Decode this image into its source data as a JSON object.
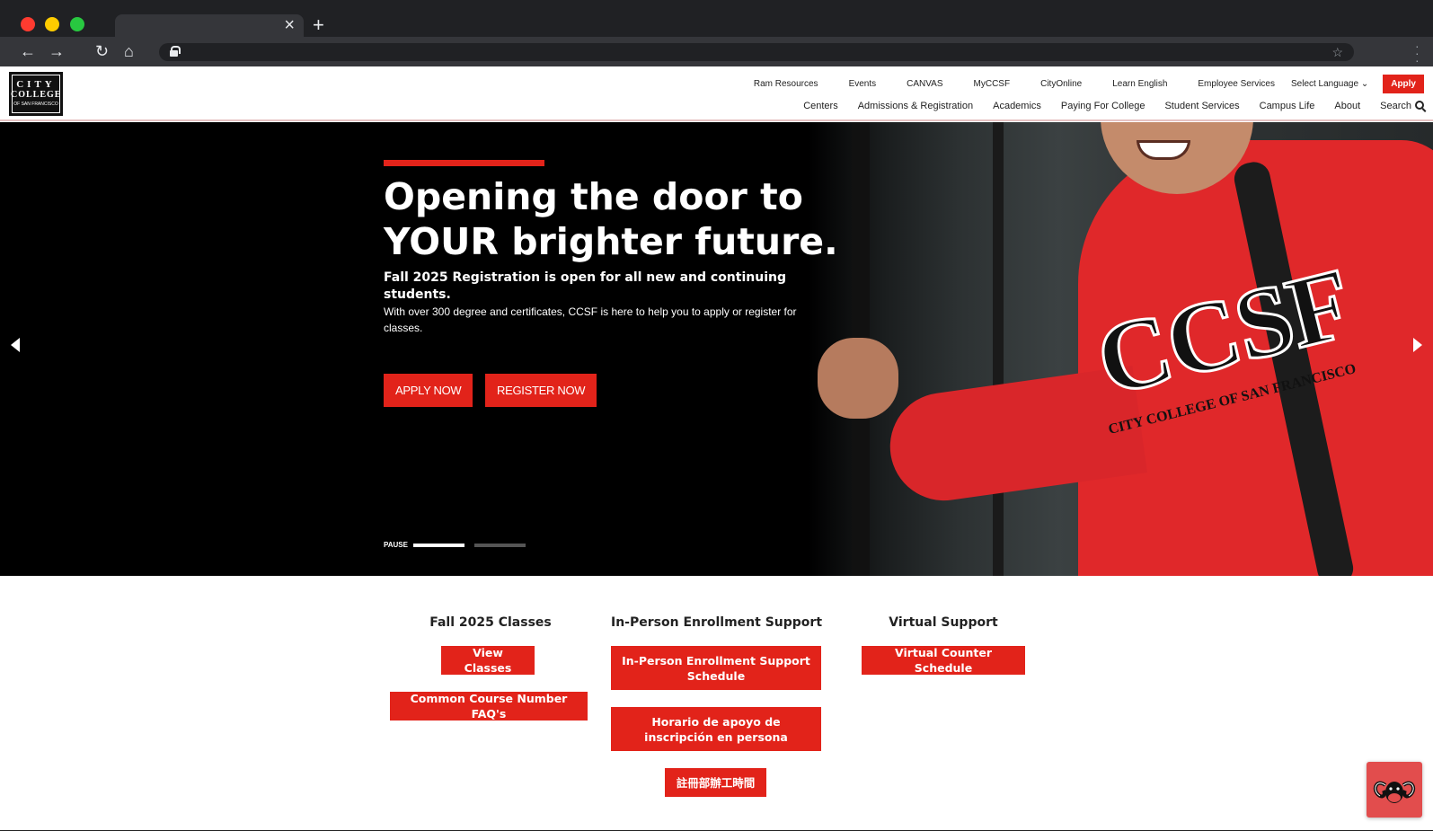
{
  "browser": {
    "new_tab_symbol": "+",
    "close_symbol": "×",
    "back_symbol": "←",
    "forward_symbol": "→",
    "reload_symbol": "↻",
    "home_symbol": "⌂",
    "star_symbol": "☆",
    "url": ""
  },
  "header": {
    "logo": {
      "line1": "CITY",
      "line2": "COLLEGE",
      "line3": "OF SAN FRANCISCO"
    },
    "utility_nav": [
      "Ram Resources",
      "Events",
      "CANVAS",
      "MyCCSF",
      "CityOnline",
      "Learn English",
      "Employee Services"
    ],
    "language": "Select Language ⌄",
    "apply_label": "Apply",
    "main_nav": [
      "Centers",
      "Admissions & Registration",
      "Academics",
      "Paying For College",
      "Student Services",
      "Campus Life",
      "About"
    ],
    "search_label": "Search"
  },
  "hero": {
    "title": "Opening the door to YOUR brighter future.",
    "subtitle": "Fall 2025 Registration is open for all new and continuing students.",
    "description": "With over 300 degree and certificates, CCSF is here to help you to apply or register for classes.",
    "apply_button": "APPLY NOW",
    "register_button": "REGISTER NOW",
    "pause_label": "PAUSE",
    "slide_count": 2,
    "active_slide": 1,
    "photo_text": "CCSF",
    "photo_subtext": "CITY COLLEGE OF SAN FRANCISCO"
  },
  "quick_links": {
    "fall_classes": {
      "title": "Fall 2025 Classes",
      "buttons": [
        "View Classes",
        "Common Course Number FAQ's"
      ]
    },
    "in_person": {
      "title": "In-Person Enrollment Support",
      "buttons": [
        "In-Person Enrollment Support Schedule",
        "Horario de apoyo de inscripción en persona",
        "註冊部辦工時間"
      ]
    },
    "virtual": {
      "title": "Virtual Support",
      "buttons": [
        "Virtual Counter Schedule"
      ]
    }
  },
  "colors": {
    "accent_red": "#e2231a",
    "hero_bg": "#000000",
    "chrome_dark": "#202124"
  }
}
